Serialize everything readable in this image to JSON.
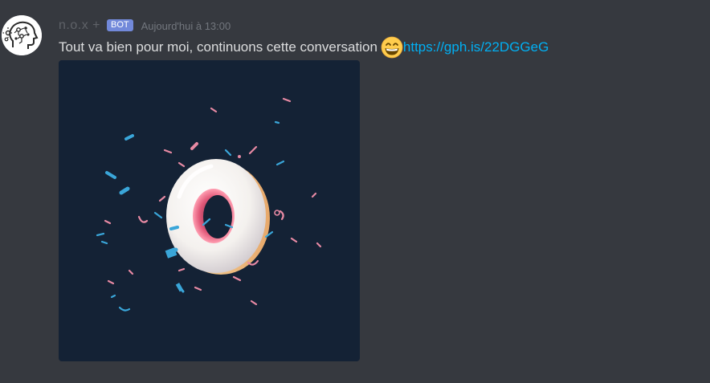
{
  "message": {
    "username": "n.o.x",
    "username_suffix": "+",
    "bot_tag": "BOT",
    "timestamp": "Aujourd'hui à 13:00",
    "text": "Tout va bien pour moi, continuons cette conversation ",
    "emoji": "grinning-face-with-smiling-eyes-icon",
    "link": "https://gph.is/22DGGeG"
  },
  "embed": {
    "type": "gif",
    "subject": "donut-with-sprinkles"
  },
  "colors": {
    "background": "#36393f",
    "username": "#5f6268",
    "bot_tag": "#7289da",
    "timestamp": "#72767d",
    "text": "#dcddde",
    "link": "#00b0f4",
    "embed_background": "#142235"
  }
}
